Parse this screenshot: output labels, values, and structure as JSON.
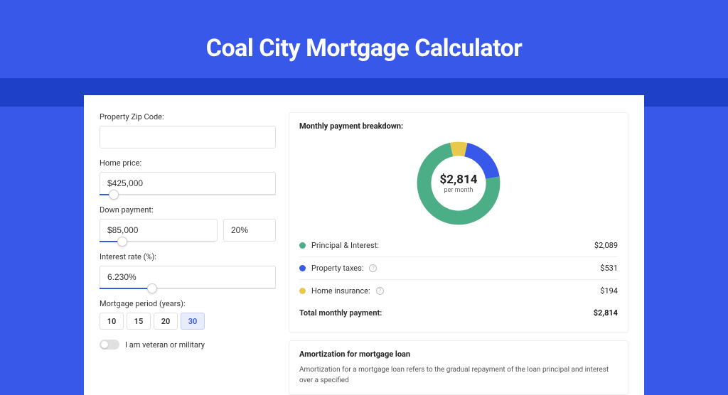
{
  "title": "Coal City Mortgage Calculator",
  "form": {
    "zip_label": "Property Zip Code:",
    "zip_value": "",
    "home_price_label": "Home price:",
    "home_price_value": "$425,000",
    "home_price_slider_pct": 8,
    "down_payment_label": "Down payment:",
    "down_payment_amount": "$85,000",
    "down_payment_pct": "20%",
    "down_payment_slider_pct": 20,
    "interest_label": "Interest rate (%):",
    "interest_value": "6.230%",
    "interest_slider_pct": 30,
    "period_label": "Mortgage period (years):",
    "periods": [
      "10",
      "15",
      "20",
      "30"
    ],
    "period_selected": "30",
    "veteran_label": "I am veteran or military"
  },
  "breakdown": {
    "title": "Monthly payment breakdown:",
    "center_amount": "$2,814",
    "center_sub": "per month",
    "items": [
      {
        "label": "Principal & Interest:",
        "value": "$2,089",
        "color": "#4cae87",
        "pct": 74.2
      },
      {
        "label": "Property taxes:",
        "value": "$531",
        "color": "#3858e9",
        "pct": 18.9,
        "help": true
      },
      {
        "label": "Home insurance:",
        "value": "$194",
        "color": "#e9c94c",
        "pct": 6.9,
        "help": true
      }
    ],
    "total_label": "Total monthly payment:",
    "total_value": "$2,814"
  },
  "amortization": {
    "title": "Amortization for mortgage loan",
    "text": "Amortization for a mortgage loan refers to the gradual repayment of the loan principal and interest over a specified"
  },
  "chart_data": {
    "type": "pie",
    "title": "Monthly payment breakdown",
    "series": [
      {
        "name": "Principal & Interest",
        "value": 2089,
        "color": "#4cae87"
      },
      {
        "name": "Property taxes",
        "value": 531,
        "color": "#3858e9"
      },
      {
        "name": "Home insurance",
        "value": 194,
        "color": "#e9c94c"
      }
    ],
    "total": 2814,
    "center_label": "$2,814 per month"
  }
}
